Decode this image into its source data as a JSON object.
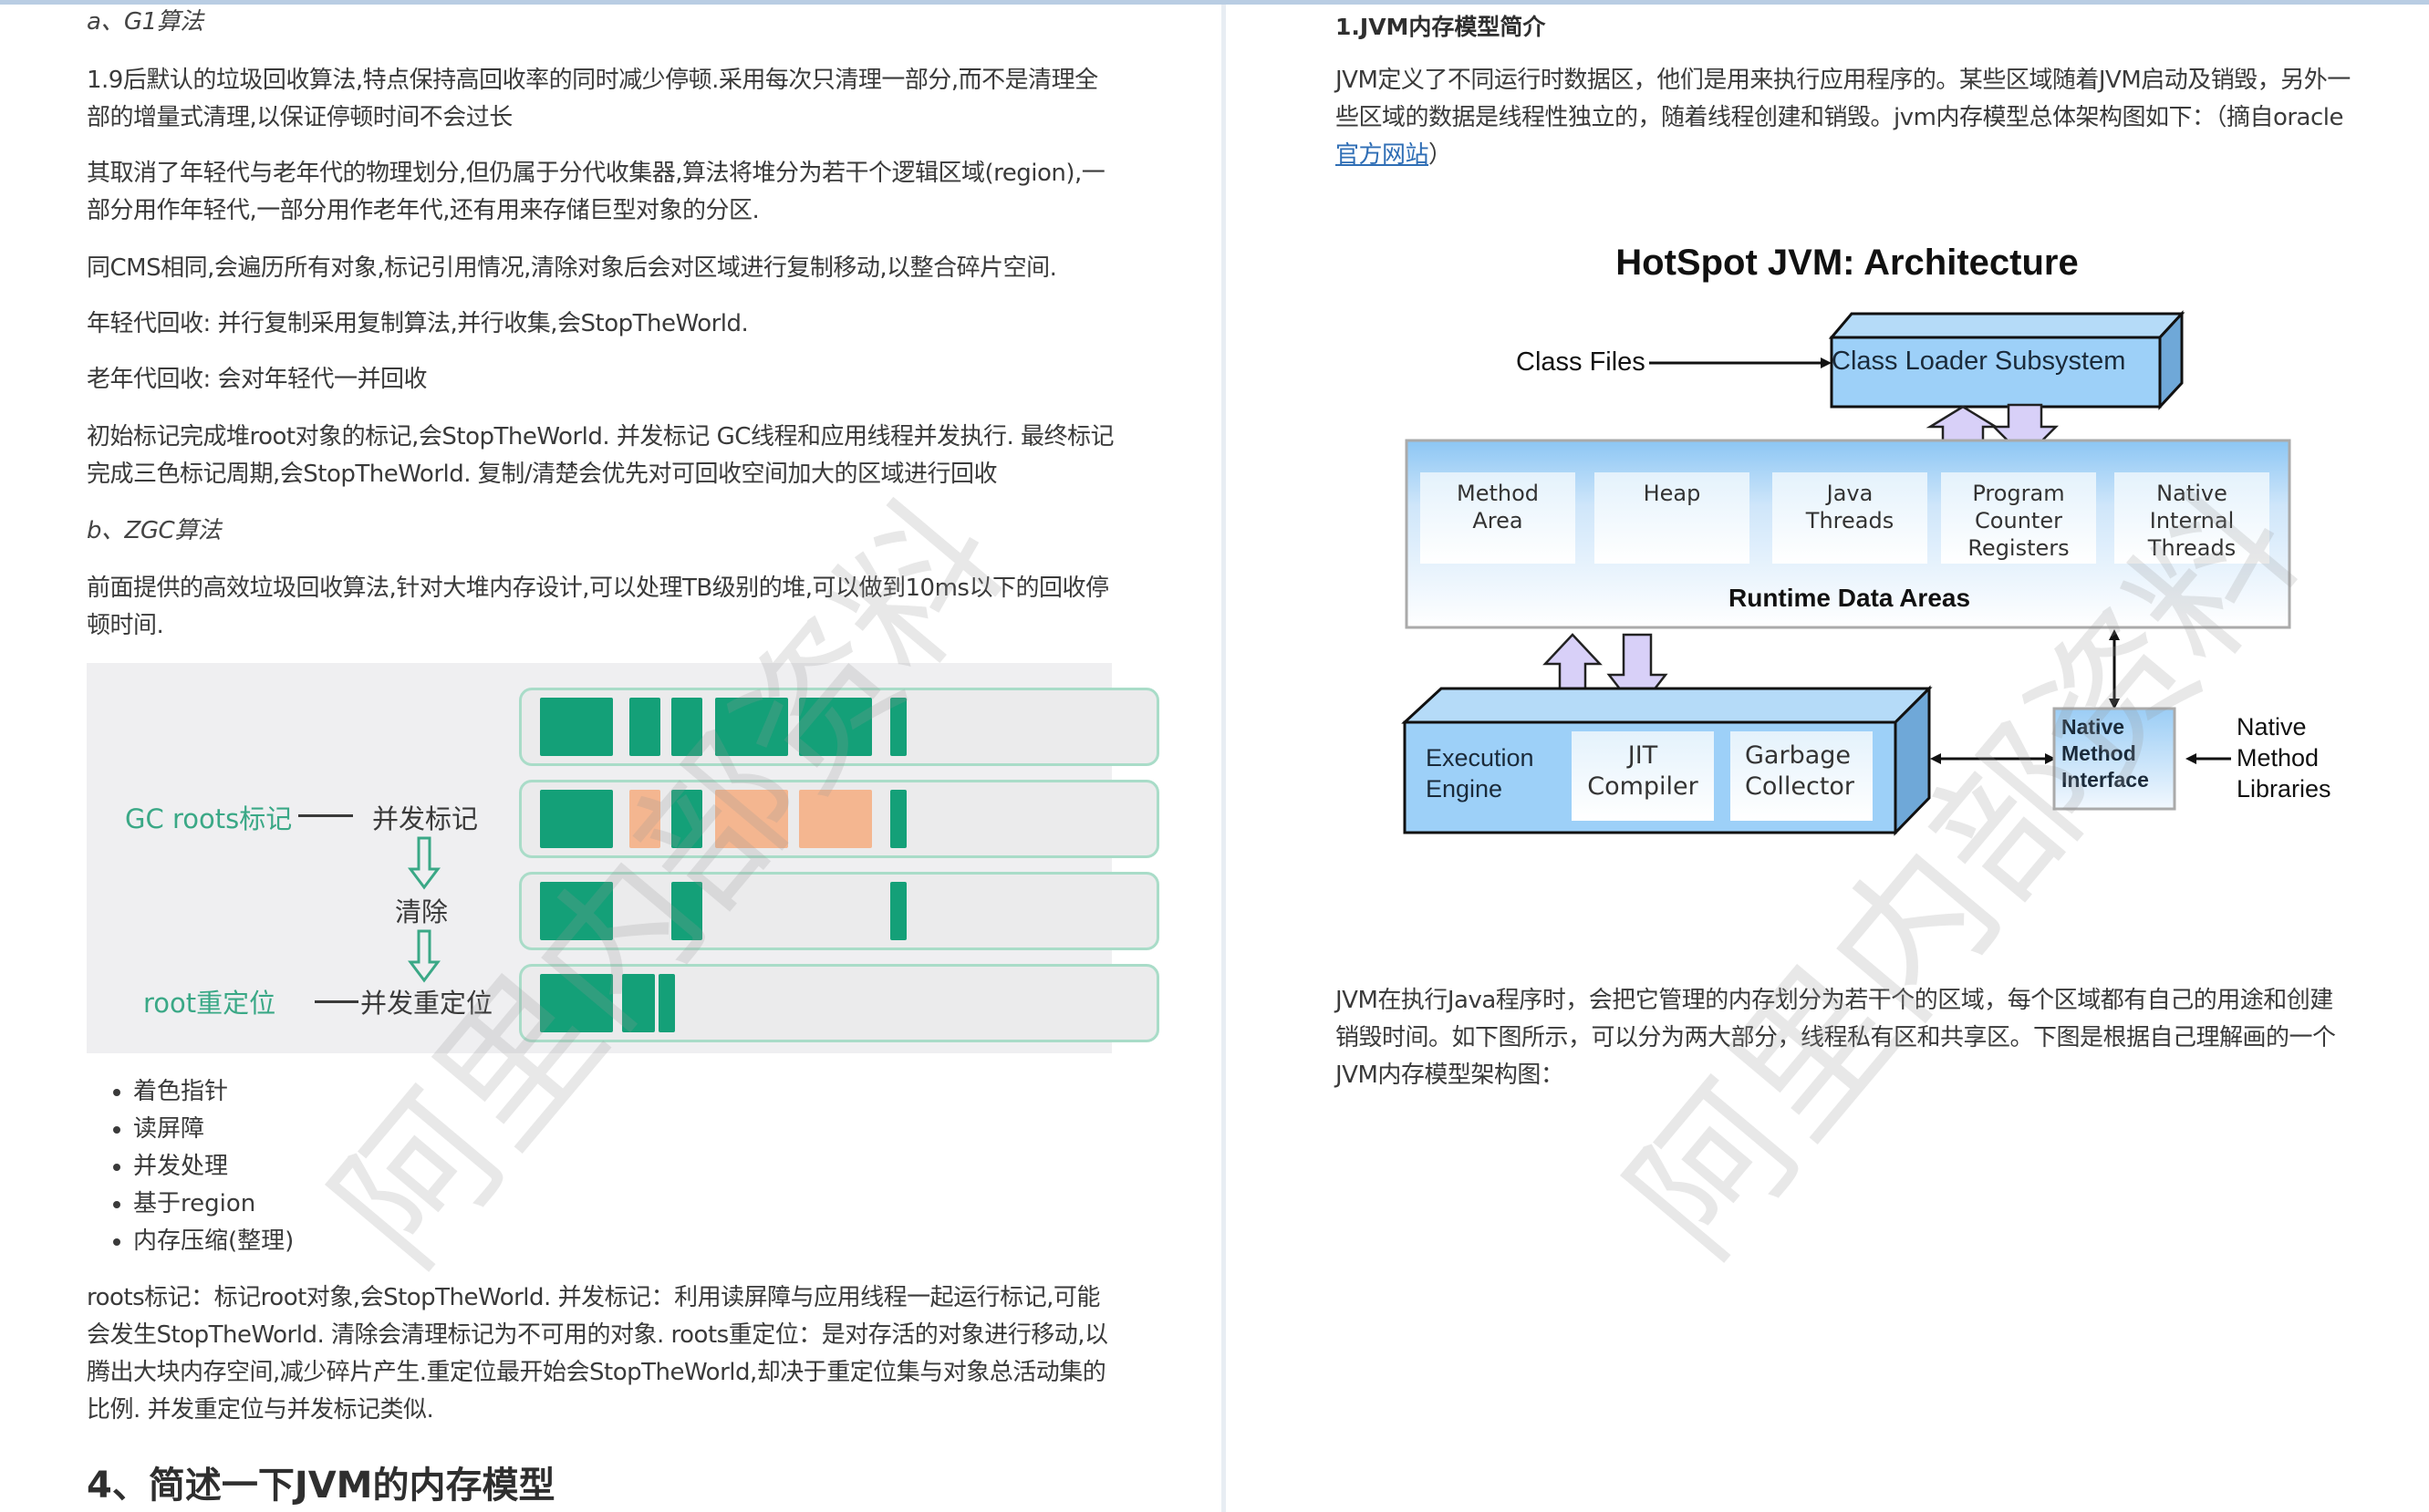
{
  "left_page": {
    "g1_heading": "a、G1算法",
    "paragraphs_g1": [
      [
        "1.9后默认的垃圾回收算法,特点保持高回收率的同时减少停顿.采用每次只清理一部分,而不是清理全",
        "部的增量式清理,以保证停顿时间不会过长"
      ],
      [
        "其取消了年轻代与老年代的物理划分,但仍属于分代收集器,算法将堆分为若干个逻辑区域(region),一",
        "部分用作年轻代,一部分用作老年代,还有用来存储巨型对象的分区."
      ],
      [
        "同CMS相同,会遍历所有对象,标记引用情况,清除对象后会对区域进行复制移动,以整合碎片空间."
      ],
      [
        "年轻代回收: 并行复制采用复制算法,并行收集,会StopTheWorld."
      ],
      [
        "老年代回收: 会对年轻代一并回收"
      ],
      [
        "初始标记完成堆root对象的标记,会StopTheWorld. 并发标记 GC线程和应用线程并发执行. 最终标记",
        "完成三色标记周期,会StopTheWorld. 复制/清楚会优先对可回收空间加大的区域进行回收"
      ]
    ],
    "zgc_heading": "b、ZGC算法",
    "zgc_paragraph": [
      "前面提供的高效垃圾回收算法,针对大堆内存设计,可以处理TB级别的堆,可以做到10ms以下的回收停",
      "顿时间."
    ],
    "gc_diagram": {
      "labels": {
        "gc_roots_mark": "GC roots标记",
        "concurrent_mark": "并发标记",
        "sweep": "清除",
        "root_relocate": "root重定位",
        "concurrent_relocate": "并发重定位"
      },
      "rows": [
        {
          "name": "initial",
          "blocks": [
            "g",
            "g",
            "g",
            "g",
            "g",
            "g"
          ]
        },
        {
          "name": "marked",
          "blocks": [
            "g",
            "o",
            "g",
            "o",
            "o",
            "g"
          ]
        },
        {
          "name": "swept",
          "blocks": [
            "g",
            "-",
            "g",
            "-",
            "-",
            "g"
          ]
        },
        {
          "name": "relocated",
          "blocks": [
            "g",
            "g",
            "g"
          ]
        }
      ],
      "colors": {
        "live": "#14a078",
        "garbage": "#f4b690",
        "label_green": "#3aa886"
      }
    },
    "features": [
      "着色指针",
      "读屏障",
      "并发处理",
      "基于region",
      "内存压缩(整理)"
    ],
    "zgc_explain": [
      "roots标记：标记root对象,会StopTheWorld. 并发标记：利用读屏障与应用线程一起运行标记,可能",
      "会发生StopTheWorld. 清除会清理标记为不可用的对象. roots重定位：是对存活的对象进行移动,以",
      "腾出大块内存空间,减少碎片产生.重定位最开始会StopTheWorld,却决于重定位集与对象总活动集的",
      "比例. 并发重定位与并发标记类似."
    ],
    "section_heading": "4、简述一下JVM的内存模型"
  },
  "right_page": {
    "title": "1.JVM内存模型简介",
    "intro": [
      "JVM定义了不同运行时数据区，他们是用来执行应用程序的。某些区域随着JVM启动及销毁，另外一",
      "些区域的数据是线程性独立的，随着线程创建和销毁。jvm内存模型总体架构图如下：（摘自oracle"
    ],
    "intro_link": "官方网站",
    "intro_tail": "）",
    "diagram": {
      "title": "HotSpot JVM: Architecture",
      "class_files": "Class Files",
      "class_loader": "Class Loader Subsystem",
      "runtime_cells": [
        [
          "Method",
          "Area"
        ],
        [
          "Heap"
        ],
        [
          "Java",
          "Threads"
        ],
        [
          "Program",
          "Counter",
          "Registers"
        ],
        [
          "Native",
          "Internal",
          "Threads"
        ]
      ],
      "runtime_label": "Runtime Data Areas",
      "execution_engine": [
        "Execution",
        "Engine"
      ],
      "jit": [
        "JIT",
        "Compiler"
      ],
      "gc": [
        "Garbage",
        "Collector"
      ],
      "nmi": [
        "Native",
        "Method",
        "Interface"
      ],
      "nml": [
        "Native",
        "Method",
        "Libraries"
      ]
    },
    "bottom": [
      "JVM在执行Java程序时，会把它管理的内存划分为若干个的区域，每个区域都有自己的用途和创建",
      "销毁时间。如下图所示，可以分为两大部分，线程私有区和共享区。下图是根据自己理解画的一个",
      "JVM内存模型架构图："
    ]
  },
  "watermark": "阿里内部资料"
}
